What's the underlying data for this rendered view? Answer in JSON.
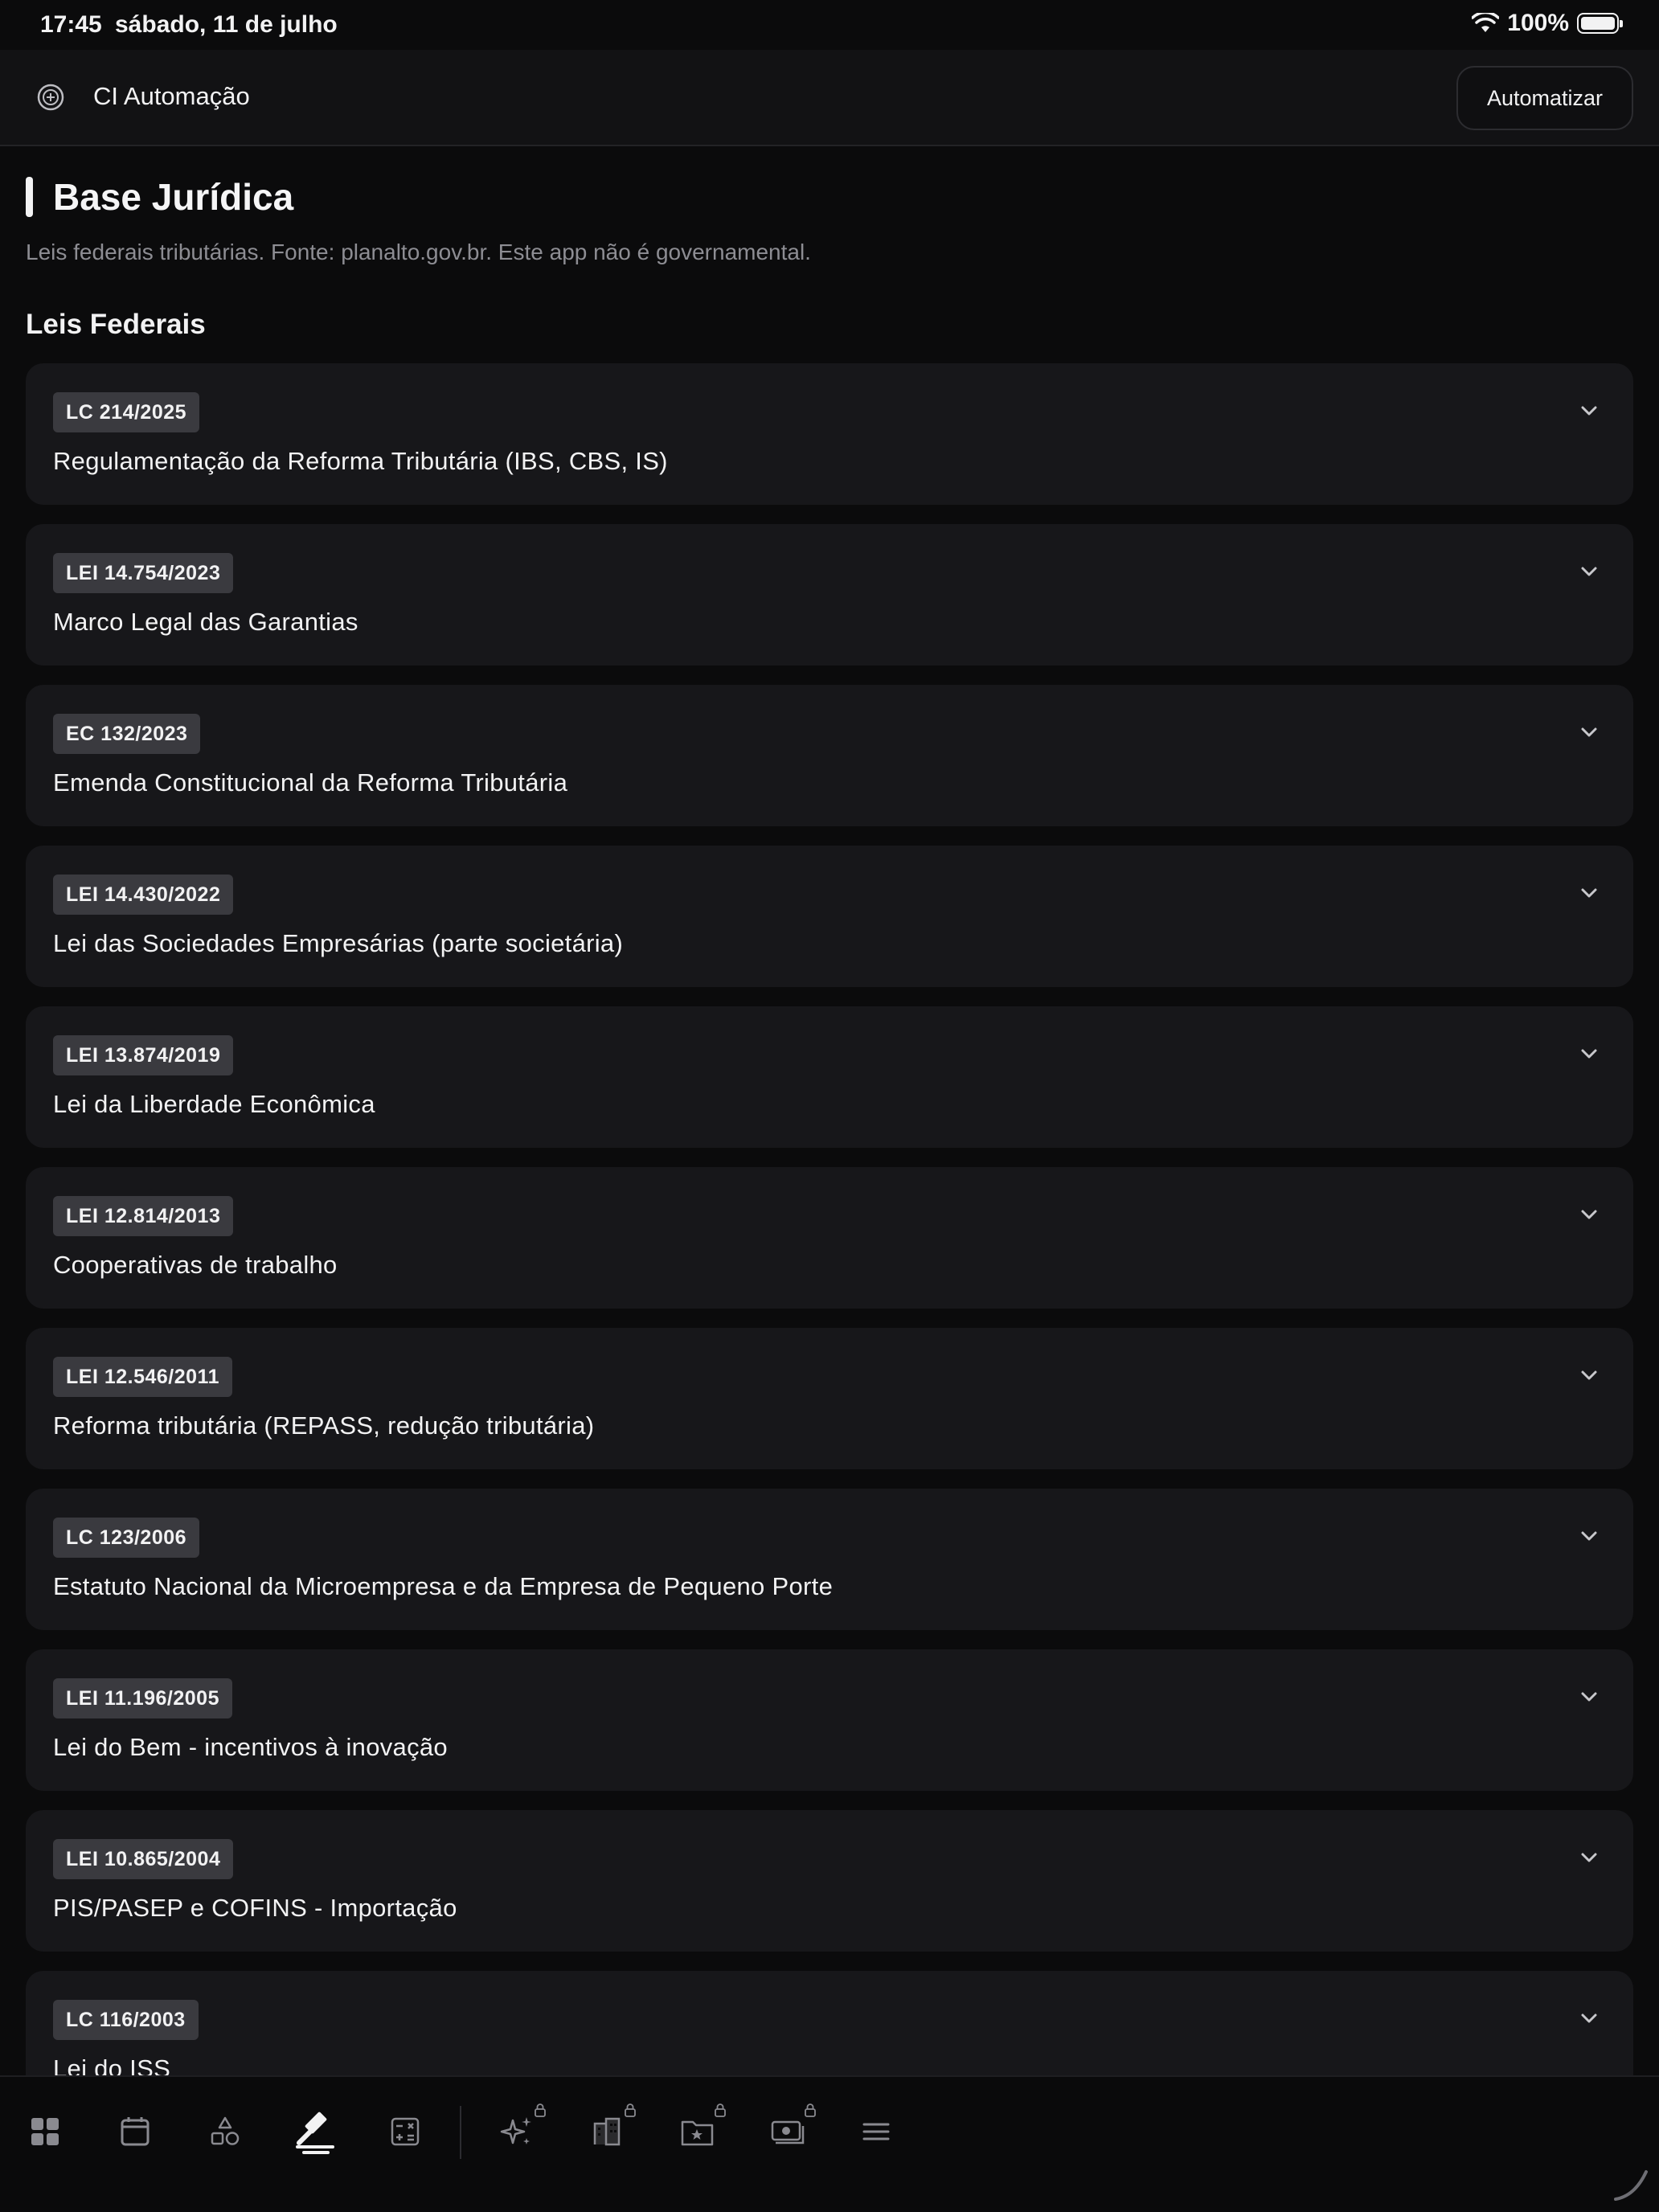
{
  "status_bar": {
    "time": "17:45",
    "date": "sábado, 11 de julho",
    "battery": "100%"
  },
  "header": {
    "app_name": "CI Automação",
    "automate_label": "Automatizar"
  },
  "page": {
    "title": "Base Jurídica",
    "subtitle": "Leis federais tributárias. Fonte: planalto.gov.br. Este app não é governamental.",
    "section_title": "Leis Federais"
  },
  "laws": [
    {
      "code": "LC 214/2025",
      "name": "Regulamentação da Reforma Tributária (IBS, CBS, IS)"
    },
    {
      "code": "LEI 14.754/2023",
      "name": "Marco Legal das Garantias"
    },
    {
      "code": "EC 132/2023",
      "name": "Emenda Constitucional da Reforma Tributária"
    },
    {
      "code": "LEI 14.430/2022",
      "name": "Lei das Sociedades Empresárias (parte societária)"
    },
    {
      "code": "LEI 13.874/2019",
      "name": "Lei da Liberdade Econômica"
    },
    {
      "code": "LEI 12.814/2013",
      "name": "Cooperativas de trabalho"
    },
    {
      "code": "LEI 12.546/2011",
      "name": "Reforma tributária (REPASS, redução tributária)"
    },
    {
      "code": "LC 123/2006",
      "name": "Estatuto Nacional da Microempresa e da Empresa de Pequeno Porte"
    },
    {
      "code": "LEI 11.196/2005",
      "name": "Lei do Bem - incentivos à inovação"
    },
    {
      "code": "LEI 10.865/2004",
      "name": "PIS/PASEP e COFINS - Importação"
    },
    {
      "code": "LC 116/2003",
      "name": "Lei do ISS"
    }
  ],
  "nav": {
    "icons": [
      "dashboard-icon",
      "calendar-icon",
      "shapes-icon",
      "gavel-icon",
      "calculator-icon",
      "sparkles-icon",
      "building-icon",
      "folder-star-icon",
      "money-icon",
      "menu-icon"
    ],
    "active": "gavel-icon",
    "locked": [
      "sparkles-icon",
      "building-icon",
      "folder-star-icon",
      "money-icon"
    ]
  },
  "colors": {
    "background": "#0b0b0c",
    "card": "#17171a",
    "badge": "#3a3a3f",
    "text": "#f2f2f3",
    "muted": "#8d8d93"
  }
}
